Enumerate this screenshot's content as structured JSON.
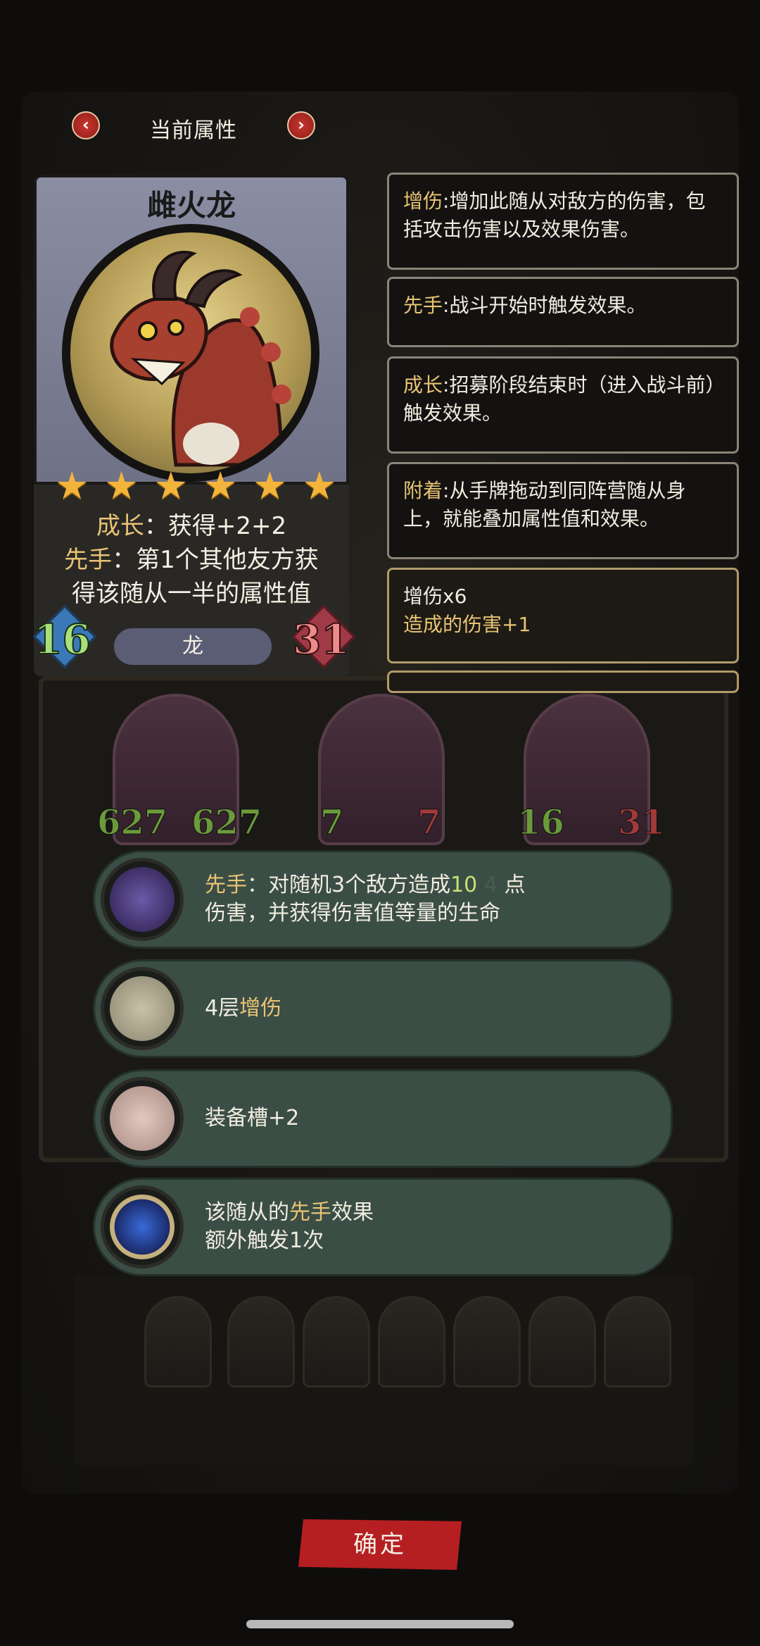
{
  "header": {
    "title": "当前属性",
    "prev_icon": "chevron-left-icon",
    "next_icon": "chevron-right-icon"
  },
  "unit": {
    "name": "雌火龙",
    "stars": 6,
    "growth_label": "成长",
    "growth_text": "：获得+2+2",
    "first_label": "先手",
    "first_text_1": "：第1个其他友方获",
    "first_text_2": "得该随从一半的属性值",
    "attack": "16",
    "health": "31",
    "tribe": "龙"
  },
  "tooltips": [
    {
      "keyword": "增伤",
      "text": ":增加此随从对敌方的伤害，包括攻击伤害以及效果伤害。"
    },
    {
      "keyword": "先手",
      "text": ":战斗开始时触发效果。"
    },
    {
      "keyword": "成长",
      "text": ":招募阶段结束时（进入战斗前）触发效果。"
    },
    {
      "keyword": "附着",
      "text": ":从手牌拖动到同阵营随从身上，就能叠加属性值和效果。"
    }
  ],
  "buff": {
    "title": "增伤x6",
    "detail": "造成的伤害+1"
  },
  "board": {
    "minions": [
      {
        "attack": "627",
        "health": "627"
      },
      {
        "attack": "7",
        "health": "7"
      },
      {
        "attack": "16",
        "health": "31"
      }
    ]
  },
  "abilities": [
    {
      "icon": "crystal-shard-icon",
      "prefix": "先手",
      "line1": "：对随机3个敌方造成",
      "value": "10",
      "dim": "4",
      "suffix": " 点",
      "line2": "伤害，并获得伤害值等量的生命"
    },
    {
      "icon": "dark-wing-icon",
      "prefix": "4层",
      "keyword": "增伤"
    },
    {
      "icon": "pig-armor-icon",
      "text": "装备槽+2"
    },
    {
      "icon": "blue-orb-amulet-icon",
      "line1_a": "该随从的",
      "keyword": "先手",
      "line1_b": "效果",
      "line2": "额外触发1次"
    }
  ],
  "confirm_label": "确定",
  "colors": {
    "accent_gold": "#e8c374",
    "confirm_red": "#b51f22",
    "ability_bg": "#3b4e46"
  }
}
